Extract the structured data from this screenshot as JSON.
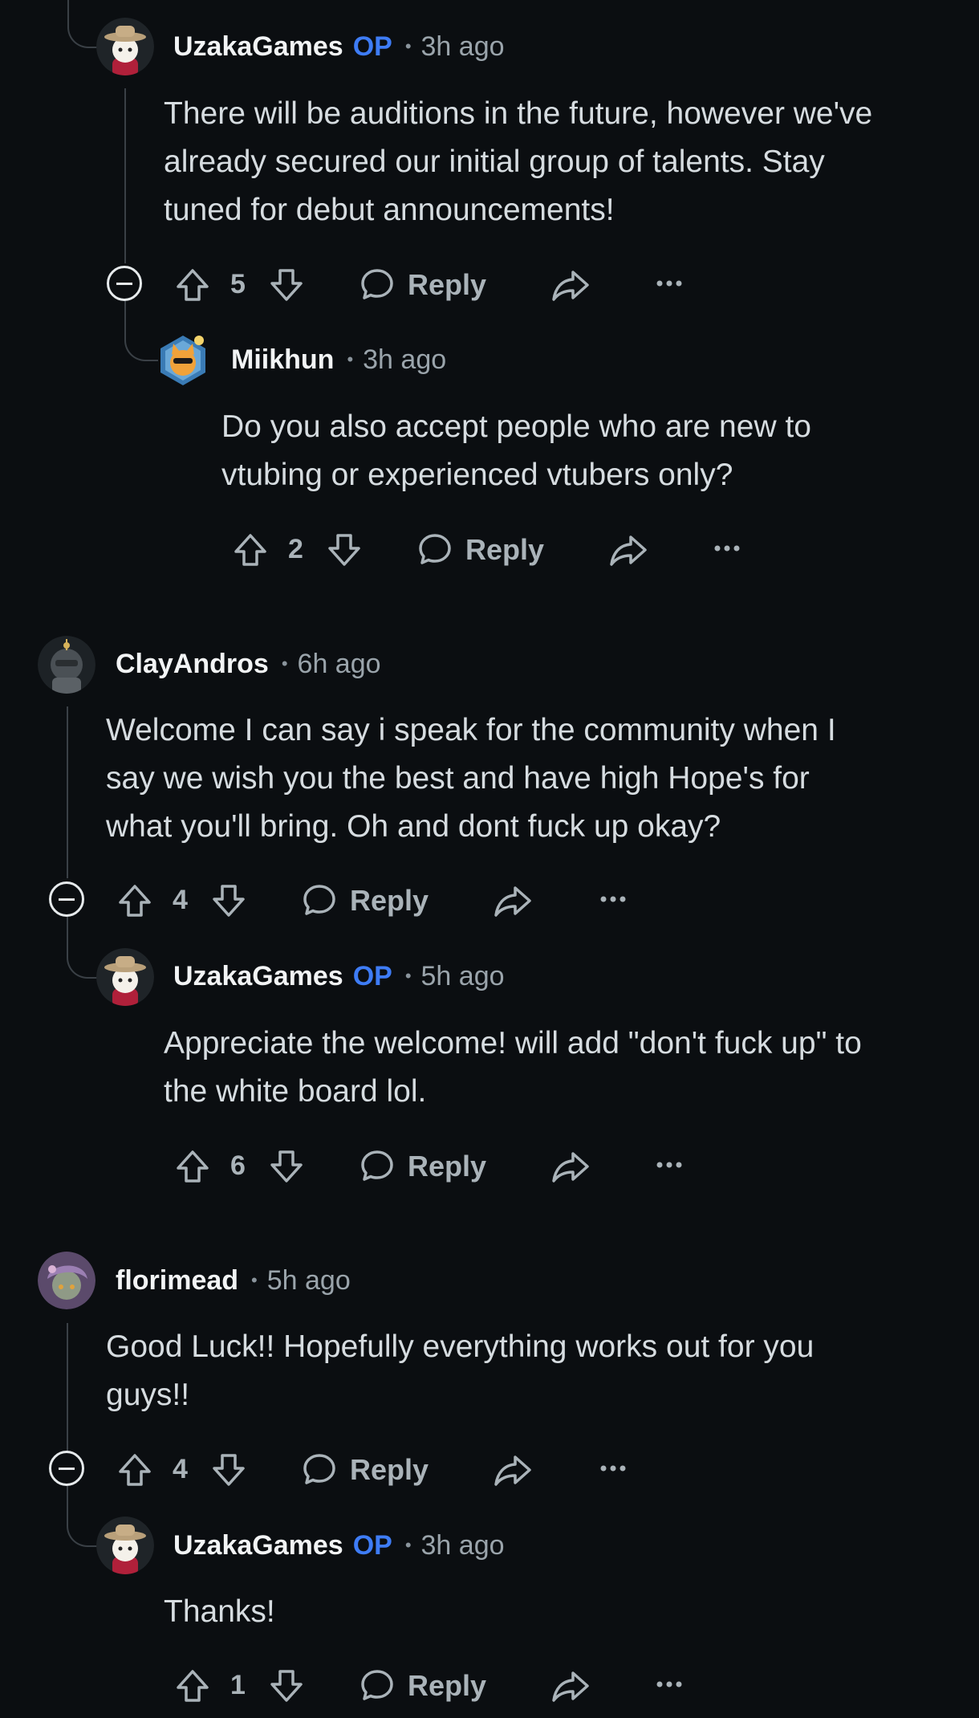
{
  "labels": {
    "op": "OP",
    "reply": "Reply",
    "dot": "•"
  },
  "colors": {
    "background": "#0b0e11",
    "op": "#3e7cf6",
    "text": "#d6dce0",
    "muted": "#9aa4ab"
  },
  "comments": [
    {
      "author": "UzakaGames",
      "op": true,
      "time": "3h ago",
      "avatar": "cowboy-avatar",
      "lines": [
        "There will be auditions in the future, however we've",
        "already secured our initial group of talents. Stay",
        "tuned for debut announcements!"
      ],
      "score": "5"
    },
    {
      "author": "Miikhun",
      "op": false,
      "time": "3h ago",
      "avatar": "cat-avatar",
      "lines": [
        "Do you also accept people who are new to",
        "vtubing or experienced vtubers only?"
      ],
      "score": "2"
    },
    {
      "author": "ClayAndros",
      "op": false,
      "time": "6h ago",
      "avatar": "knight-avatar",
      "lines": [
        "Welcome I can say i speak for the community when I",
        "say we wish you the best and have high Hope's for",
        "what you'll bring. Oh and dont fuck up okay?"
      ],
      "score": "4"
    },
    {
      "author": "UzakaGames",
      "op": true,
      "time": "5h ago",
      "avatar": "cowboy-avatar",
      "lines": [
        "Appreciate the welcome! will add \"don't fuck up\" to",
        "the white board lol."
      ],
      "score": "6"
    },
    {
      "author": "florimead",
      "op": false,
      "time": "5h ago",
      "avatar": "purple-hair-avatar",
      "lines": [
        "Good Luck!! Hopefully everything works out for you",
        "guys!!"
      ],
      "score": "4"
    },
    {
      "author": "UzakaGames",
      "op": true,
      "time": "3h ago",
      "avatar": "cowboy-avatar",
      "lines": [
        "Thanks!"
      ],
      "score": "1"
    }
  ]
}
